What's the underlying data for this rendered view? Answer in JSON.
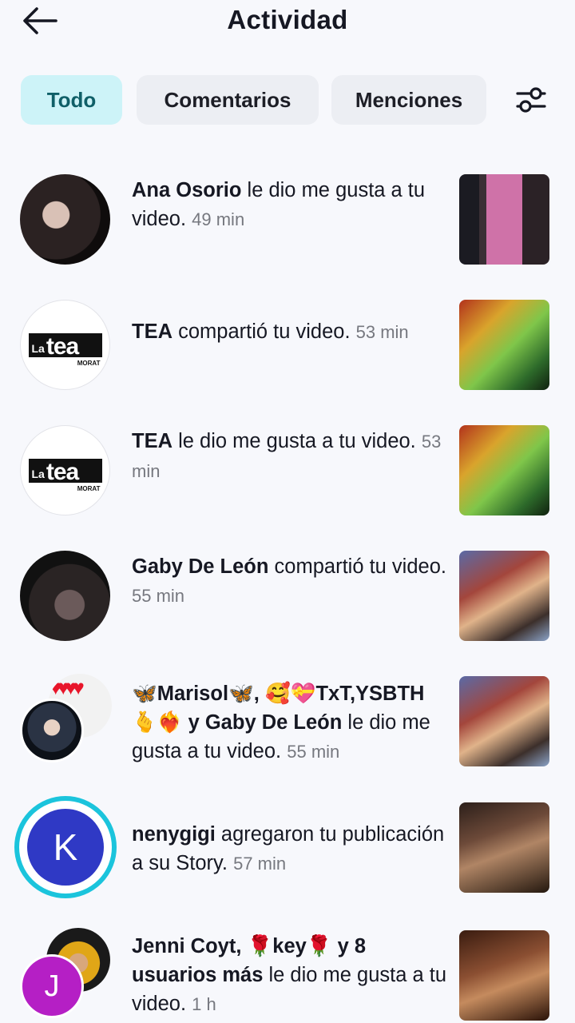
{
  "header": {
    "title": "Actividad"
  },
  "tabs": [
    {
      "label": "Todo",
      "active": true
    },
    {
      "label": "Comentarios",
      "active": false
    },
    {
      "label": "Menciones",
      "active": false
    }
  ],
  "colors": {
    "active_tab_bg": "#cdf3f8",
    "story_ring": "#1bc4dc",
    "avatar_k": "#2f39c5",
    "avatar_j": "#b51fc5"
  },
  "items": [
    {
      "name": "Ana Osorio",
      "action": " le dio me gusta a tu video.",
      "time": "49 min"
    },
    {
      "name": "TEA",
      "action": " compartió tu video.",
      "time": "53 min",
      "avatar_logo": {
        "la": "La",
        "word": "tea",
        "sub": "MORAT"
      }
    },
    {
      "name": "TEA",
      "action": " le dio me gusta a tu video.",
      "time": "53 min",
      "avatar_logo": {
        "la": "La",
        "word": "tea",
        "sub": "MORAT"
      }
    },
    {
      "name": "Gaby De León",
      "action": " compartió tu video.",
      "time": "55 min"
    },
    {
      "name": "🦋Marisol🦋, 🥰💝TxT,YSBTH🫰❤️‍🔥 y Gaby De León",
      "action": " le dio me gusta a tu video.",
      "time": "55 min"
    },
    {
      "name": "nenygigi",
      "action": " agregaron tu publicación a su Story.",
      "time": "57 min",
      "avatar_letter": "K"
    },
    {
      "name": "Jenni Coyt, 🌹key🌹 y 8 usuarios más",
      "action": " le dio me gusta a tu video.",
      "time": "1 h",
      "avatar_letter": "J"
    }
  ]
}
